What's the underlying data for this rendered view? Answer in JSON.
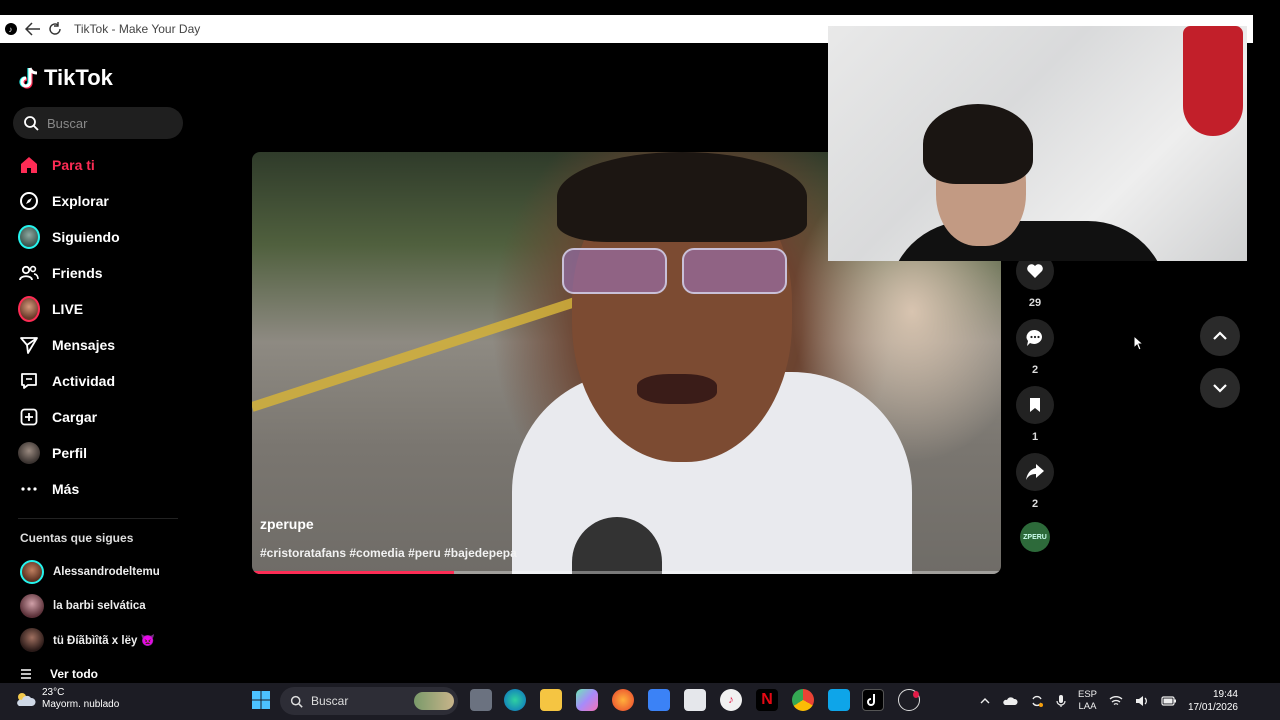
{
  "window": {
    "title": "TikTok - Make Your Day"
  },
  "brand": {
    "name": "TikTok",
    "accent": "#fe2c55"
  },
  "search": {
    "placeholder": "Buscar"
  },
  "nav": [
    {
      "label": "Para ti",
      "icon": "home-icon",
      "active": true
    },
    {
      "label": "Explorar",
      "icon": "compass-icon"
    },
    {
      "label": "Siguiendo",
      "icon": "following-avatar-icon"
    },
    {
      "label": "Friends",
      "icon": "friends-icon"
    },
    {
      "label": "LIVE",
      "icon": "live-avatar-icon"
    },
    {
      "label": "Mensajes",
      "icon": "messages-icon"
    },
    {
      "label": "Actividad",
      "icon": "activity-icon"
    },
    {
      "label": "Cargar",
      "icon": "upload-icon"
    },
    {
      "label": "Perfil",
      "icon": "profile-avatar-icon"
    },
    {
      "label": "Más",
      "icon": "more-icon"
    }
  ],
  "following": {
    "title": "Cuentas que sigues",
    "accounts": [
      {
        "name": "Alessandrodeltemu"
      },
      {
        "name": "la barbi selvática"
      },
      {
        "name": "tü Ðíãbìîtã x lëy 👿"
      }
    ],
    "see_all": "Ver todo"
  },
  "video": {
    "username": "zperupe",
    "hashtags": "#cristoratafans #comedia #peru #bajedepepa",
    "progress": 0.27
  },
  "actions": {
    "likes": "29",
    "comments": "2",
    "saves": "1",
    "shares": "2",
    "creator_badge": "ZPERU"
  },
  "taskbar": {
    "weather_temp": "23°C",
    "weather_desc": "Mayorm. nublado",
    "search": "Buscar",
    "lang_top": "ESP",
    "lang_bottom": "LAA",
    "time": "19:44",
    "date": "17/01/2026"
  }
}
